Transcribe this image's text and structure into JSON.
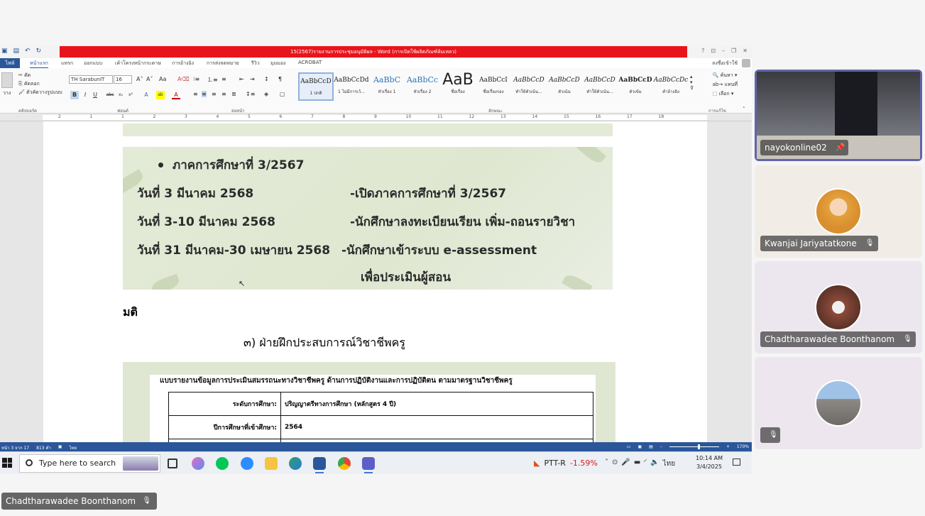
{
  "word": {
    "window_title": "15(2567)รายงานการประชุมอนุมัติผล - Word (การเปิดใช้ผลิตภัณฑ์ล้มเหลว)",
    "tabs": [
      "ไฟล์",
      "หน้าแรก",
      "แทรก",
      "ออกแบบ",
      "เค้าโครงหน้ากระดาษ",
      "การอ้างอิง",
      "การส่งจดหมาย",
      "รีวิว",
      "มุมมอง",
      "ACROBAT"
    ],
    "user": "ลงชื่อเข้าใช้",
    "clipboard": {
      "paste": "วาง",
      "cut": "ตัด",
      "copy": "คัดลอก",
      "format_painter": "ตัวคัดวางรูปแบบ",
      "group": "คลิปบอร์ด"
    },
    "font": {
      "name": "TH SarabunIT",
      "size": "16",
      "group": "ฟอนต์"
    },
    "paragraph_group": "ย่อหน้า",
    "styles_group": "ลักษณะ",
    "editing": {
      "find": "ค้นหา",
      "replace": "แทนที่",
      "select": "เลือก",
      "group": "การแก้ไข"
    },
    "styles": [
      {
        "preview": "AaBbCcD",
        "label": "1 ปกติ",
        "kind": "normal"
      },
      {
        "preview": "AaBbCcDd",
        "label": "1 ไม่มีการเว้...",
        "kind": "normal"
      },
      {
        "preview": "AaBbC",
        "label": "หัวเรื่อง 1",
        "kind": "blue"
      },
      {
        "preview": "AaBbCc",
        "label": "หัวเรื่อง 2",
        "kind": "blue"
      },
      {
        "preview": "AaB",
        "label": "ชื่อเรื่อง",
        "kind": "big"
      },
      {
        "preview": "AaBbCcI",
        "label": "ชื่อเรื่องรอง",
        "kind": "normal"
      },
      {
        "preview": "AaBbCcD",
        "label": "ทำให้ตัวเน้น...",
        "kind": "it"
      },
      {
        "preview": "AaBbCcD",
        "label": "ตัวเน้น",
        "kind": "it"
      },
      {
        "preview": "AaBbCcD",
        "label": "ทำให้ตัวเน้น...",
        "kind": "it"
      },
      {
        "preview": "AaBbCcD",
        "label": "ตัวเข้ม",
        "kind": "bold"
      },
      {
        "preview": "AaBbCcDc",
        "label": "คำอ้างอิง",
        "kind": "it"
      }
    ],
    "ruler": [
      "2",
      "1",
      "1",
      "2",
      "3",
      "4",
      "5",
      "6",
      "7",
      "8",
      "9",
      "10",
      "11",
      "12",
      "13",
      "14",
      "15",
      "16",
      "17",
      "18"
    ]
  },
  "document": {
    "slide": {
      "line0": "ภาคการศึกษาที่ 3/2567",
      "rows": [
        {
          "date": "วันที่ 3 มีนาคม 2568",
          "event": "-เปิดภาคการศึกษาที่ 3/2567"
        },
        {
          "date": "วันที่ 3-10 มีนาคม 2568",
          "event": "-นักศึกษาลงทะเบียนเรียน เพิ่ม-ถอนรายวิชา"
        },
        {
          "date": "วันที่ 31 มีนาคม-30 เมษายน 2568",
          "event": "-นักศึกษาเข้าระบบ e-assessment"
        }
      ],
      "continuation": "เพื่อประเมินผู้สอน"
    },
    "resolution": "มติ",
    "section": "๓) ฝ่ายฝึกประสบการณ์วิชาชีพครู",
    "table_heading": "แบบรายงานข้อมูลการประเมินสมรรถนะทางวิชาชีพครู ด้านการปฏิบัติงานและการปฏิบัติตน ตามมาตรฐานวิชาชีพครู",
    "table_rows": [
      {
        "key": "ระดับการศึกษา:",
        "value": "ปริญญาตรีทางการศึกษา (หลักสูตร 4 ปี)"
      },
      {
        "key": "ปีการศึกษาที่เข้าศึกษา:",
        "value": "2564"
      }
    ]
  },
  "statusbar": {
    "page": "หน้า 3 จาก 17",
    "words": "813 คำ",
    "lang": "ไทย",
    "zoom": "170%"
  },
  "taskbar": {
    "search_placeholder": "Type here to search",
    "stock_name": "PTT-R",
    "stock_change": "-1.59%",
    "time": "10:14 AM",
    "date": "3/4/2025",
    "lang": "ไทย"
  },
  "participants": [
    {
      "name": "nayokonline02",
      "pinned": true
    },
    {
      "name": "Kwanjai Jariyatatkone",
      "muted": true
    },
    {
      "name": "Chadtharawadee Boonthanom",
      "muted": true
    },
    {
      "name": "",
      "muted": true
    }
  ],
  "presenter_name": "Chadtharawadee Boonthanom",
  "colors": {
    "word_blue": "#2b579a",
    "title_red": "#e8141b",
    "speaker_border": "#6264a7"
  }
}
